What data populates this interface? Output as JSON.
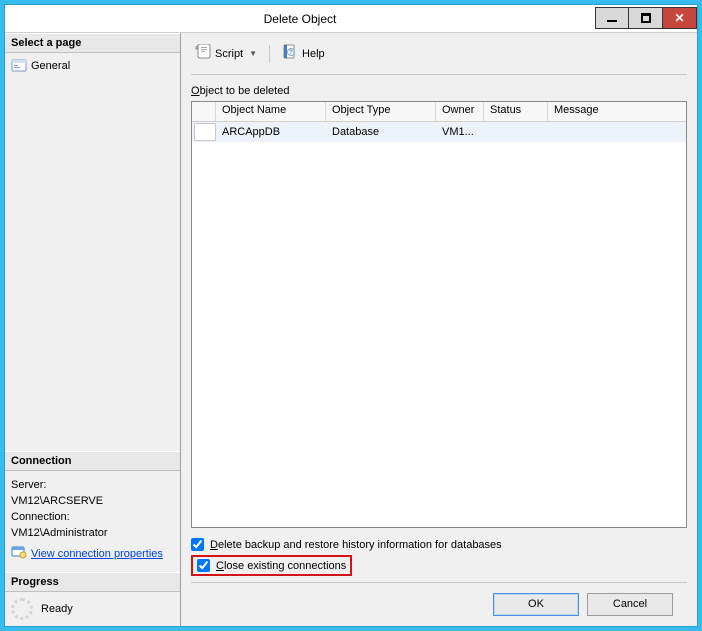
{
  "window": {
    "title": "Delete Object"
  },
  "left": {
    "select_page_header": "Select a page",
    "general": "General",
    "connection_header": "Connection",
    "server_label": "Server:",
    "server_value": "VM12\\ARCSERVE",
    "connection_label": "Connection:",
    "connection_value": "VM12\\Administrator",
    "view_props_link": "View connection properties",
    "progress_header": "Progress",
    "progress_status": "Ready"
  },
  "toolbar": {
    "script_label": "Script",
    "help_label": "Help"
  },
  "main": {
    "object_to_be_deleted_label": "Object to be deleted",
    "columns": {
      "name": "Object Name",
      "type": "Object Type",
      "owner": "Owner",
      "status": "Status",
      "message": "Message"
    },
    "row": {
      "name": "ARCAppDB",
      "type": "Database",
      "owner": "VM1...",
      "status": "",
      "message": ""
    },
    "delete_history_label": "Delete backup and restore history information for databases",
    "close_conn_label": "Close existing connections"
  },
  "footer": {
    "ok": "OK",
    "cancel": "Cancel"
  }
}
